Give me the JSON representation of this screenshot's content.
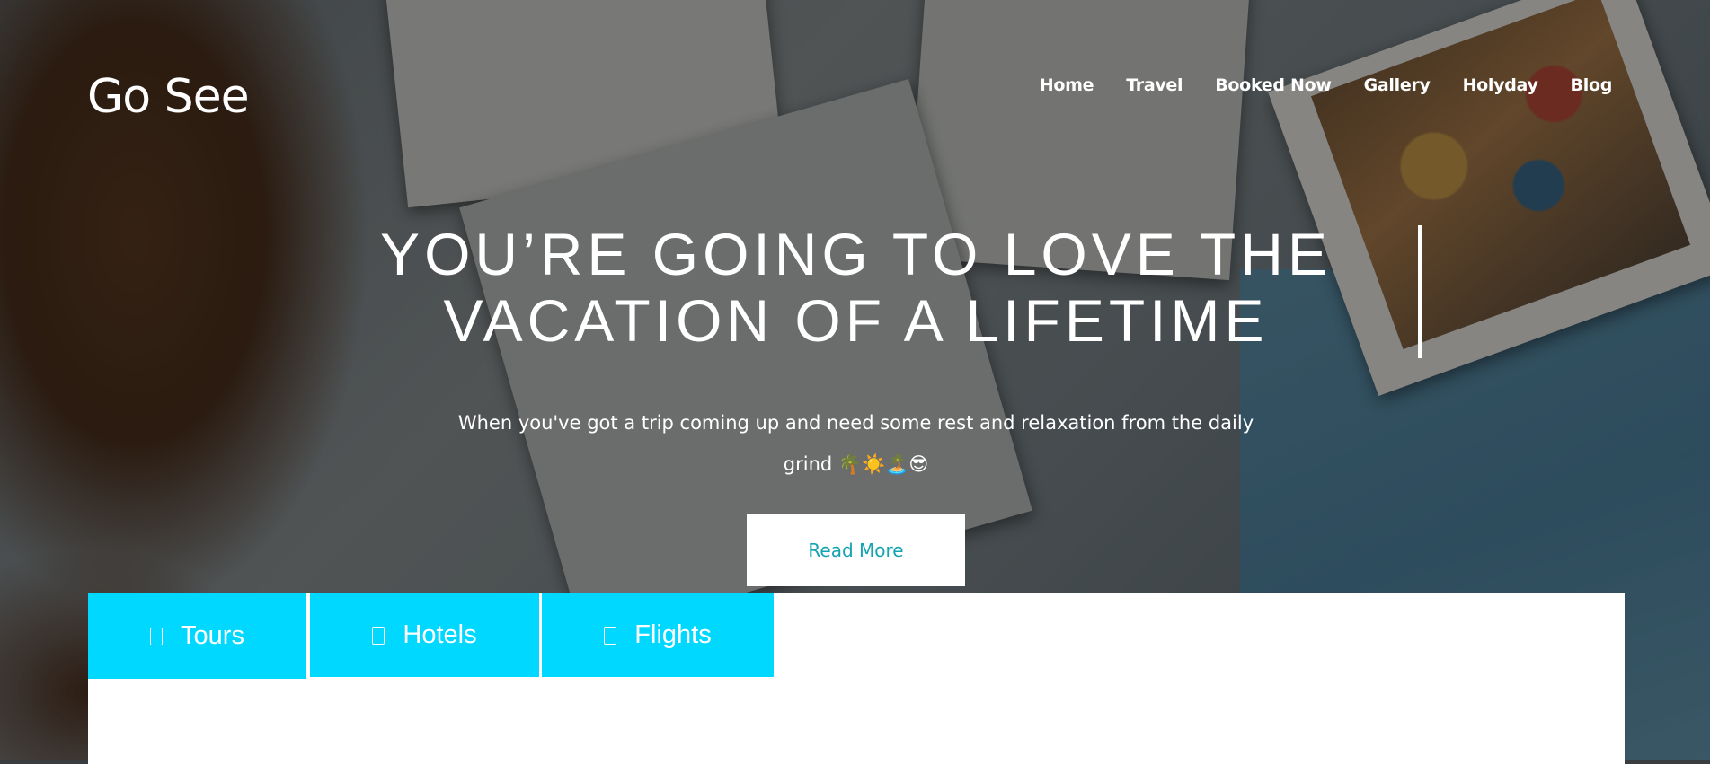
{
  "brand": {
    "name": "Go See"
  },
  "nav": {
    "items": [
      {
        "label": "Home"
      },
      {
        "label": "Travel"
      },
      {
        "label": "Booked Now"
      },
      {
        "label": "Gallery"
      },
      {
        "label": "Holyday"
      },
      {
        "label": "Blog"
      }
    ]
  },
  "hero": {
    "headline_line1": "YOU’RE GOING TO LOVE THE",
    "headline_line2": "VACATION OF A LIFETIME",
    "subtitle_line1": "When you've got a trip coming up and need some rest and relaxation from the daily",
    "subtitle_line2": "grind 🌴☀️🏝️😎",
    "cta_label": "Read More"
  },
  "booking": {
    "tabs": [
      {
        "label": "Tours",
        "icon": "tours-icon"
      },
      {
        "label": "Hotels",
        "icon": "hotels-icon"
      },
      {
        "label": "Flights",
        "icon": "flights-icon"
      }
    ]
  },
  "colors": {
    "tab_bg": "#00d8ff",
    "cta_text": "#14a3b0",
    "text_light": "#ffffff"
  }
}
